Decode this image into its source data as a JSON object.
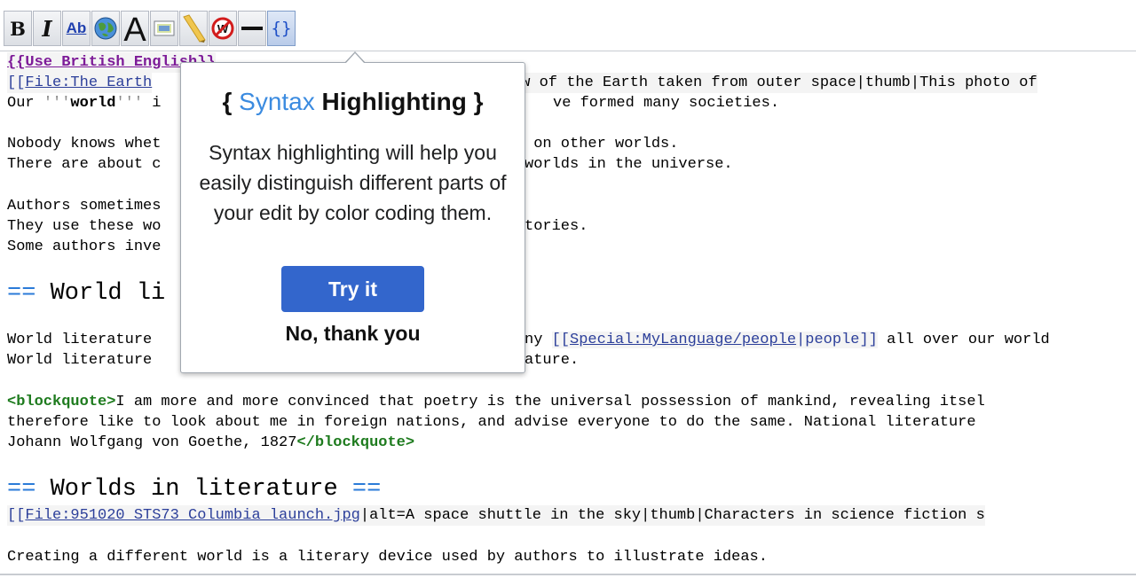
{
  "toolbar": {
    "bold_label": "B",
    "italic_label": "I",
    "link_label": "Ab",
    "heading_label": "A",
    "syntax_label": "{}",
    "icons": [
      "bold-icon",
      "italic-icon",
      "internal-link-icon",
      "external-link-globe-icon",
      "headline-icon",
      "embedded-file-icon",
      "media-file-icon",
      "nowiki-icon",
      "horizontal-line-icon",
      "syntax-highlight-icon"
    ]
  },
  "editor": {
    "l1": "{{Use British English}}",
    "l2a": "[[",
    "l2b": "File:The Earth",
    "l2c": "ew of the Earth taken from outer space|thumb|This photo of",
    "l3a": "Our ",
    "l3b": "'''",
    "l3c": "world",
    "l3d": "'''",
    "l3e": " i",
    "l3f": "ve formed many societies.",
    "l4a": "Nobody knows whet",
    "l4b": " on other worlds.",
    "l5a": "There are about c",
    "l5b": "worlds in the universe.",
    "l6a": "Authors sometimes",
    "l7a": "They use these wo",
    "l7b": "tories.",
    "l8a": "Some authors inve",
    "h1a": "==",
    "h1b": " World li",
    "l9a": "World literature ",
    "l9b": "ny ",
    "l9c": "[[",
    "l9d": "Special:MyLanguage/people",
    "l9e": "|people]]",
    "l9f": " all over our world",
    "l10a": "World literature ",
    "l10b": "ature.",
    "l11a": "<blockquote>",
    "l11b": "I am more and more convinced that poetry is the universal possession of mankind, revealing itsel",
    "l12": "therefore like to look about me in foreign nations, and advise everyone to do the same. National literature",
    "l13a": "Johann Wolfgang von Goethe, 1827",
    "l13b": "</blockquote>",
    "h2a": "==",
    "h2b": " Worlds in literature ",
    "h2c": "==",
    "l14a": "[[",
    "l14b": "File:951020 STS73 Columbia launch.jpg",
    "l14c": "|alt=A space shuttle in the sky|thumb|Characters in science fiction s",
    "l15": "Creating a different world is a literary device used by authors to illustrate ideas."
  },
  "popup": {
    "title_open": "{ ",
    "title_word": "Syntax",
    "title_rest": " Highlighting }",
    "body": "Syntax highlighting will help you easily distinguish different parts of your edit by color coding them.",
    "try_label": "Try it",
    "dismiss_label": "No, thank you"
  }
}
